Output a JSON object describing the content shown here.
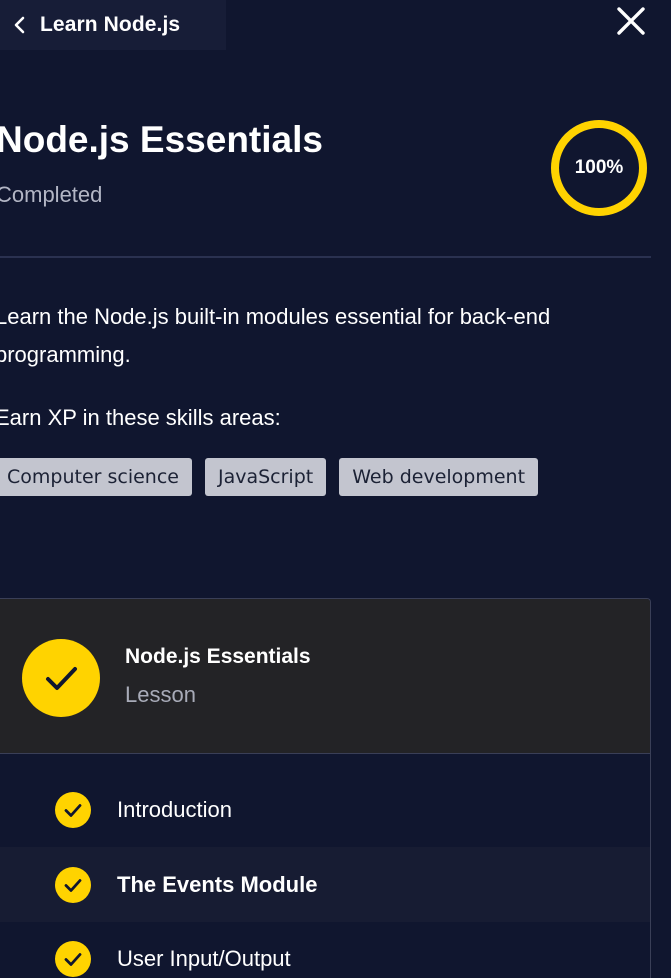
{
  "nav": {
    "back_label": "Learn Node.js"
  },
  "course": {
    "title": "Node.js Essentials",
    "status": "Completed",
    "progress_label": "100%",
    "progress_fraction": 1.0,
    "description": "Learn the Node.js built-in modules essential for back-end programming.",
    "skills_heading": "Earn XP in these skills areas:",
    "skills": [
      "Computer science",
      "JavaScript",
      "Web development"
    ]
  },
  "lesson": {
    "name": "Node.js Essentials",
    "type": "Lesson",
    "items": [
      {
        "label": "Introduction",
        "completed": true
      },
      {
        "label": "The Events Module",
        "completed": true
      },
      {
        "label": "User Input/Output",
        "completed": true
      }
    ]
  },
  "colors": {
    "background": "#10162f",
    "accent": "#ffd300",
    "tag_bg": "#c3c5cf",
    "muted_text": "#b3b6c5"
  },
  "icons": {
    "back": "chevron-left-icon",
    "close": "close-icon",
    "check": "check-circle-icon"
  }
}
